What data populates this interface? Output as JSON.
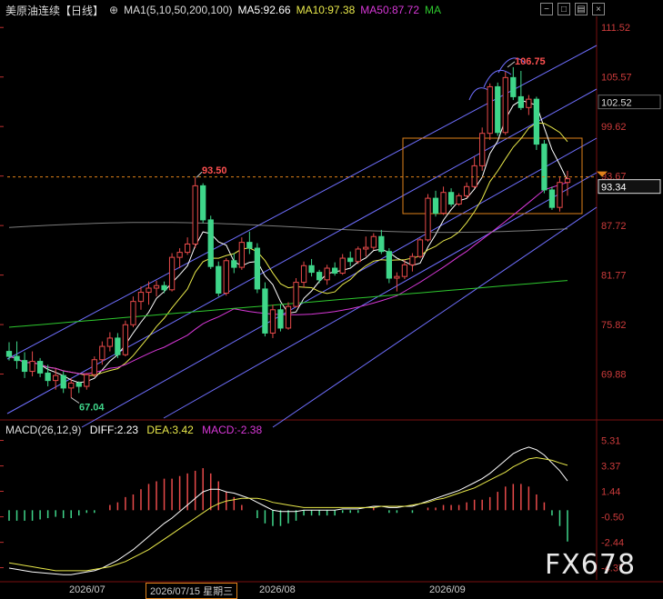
{
  "header": {
    "title": "美原油连续",
    "period": "【日线】",
    "ma_label": "MA1(5,10,50,200,100)",
    "ma5": "MA5:92.66",
    "ma10": "MA10:97.38",
    "ma50": "MA50:87.72",
    "ma_extra": "MA"
  },
  "macd_header": {
    "label": "MACD(26,12,9)",
    "diff": "DIFF:2.23",
    "dea": "DEA:3.42",
    "macd": "MACD:-2.38"
  },
  "price_axis": {
    "ticks": [
      "111.52",
      "105.57",
      "99.62",
      "93.67",
      "87.72",
      "81.77",
      "75.82",
      "69.88"
    ],
    "tick_values": [
      111.52,
      105.57,
      99.62,
      93.67,
      87.72,
      81.77,
      75.82,
      69.88
    ],
    "boxed_label": "102.52",
    "current_label": "93.34",
    "current_value": 93.34
  },
  "macd_axis": {
    "ticks": [
      "5.31",
      "3.37",
      "1.44",
      "-0.50",
      "-2.44",
      "-4.37"
    ],
    "tick_values": [
      5.31,
      3.37,
      1.44,
      -0.5,
      -2.44,
      -4.37
    ]
  },
  "annotations": {
    "high_label": "106.75",
    "high_value": 106.75,
    "mid_label": "93.50",
    "mid_value": 93.5,
    "low_label": "67.04",
    "low_value": 67.04
  },
  "x_axis": {
    "labels": [
      "2026/07",
      "2026/07/15 星期三",
      "2026/08",
      "2026/09"
    ]
  },
  "watermark": "FX678",
  "colors": {
    "up": "#e84a4a",
    "down": "#3fd68a",
    "ma5": "#ffffff",
    "ma10": "#e8e84a",
    "ma50": "#d838d8",
    "ma_long": "#2ec82e",
    "ma_mid": "#9a9a9a",
    "channel": "#6f6fff",
    "box": "#e0821a",
    "macd_up": "#e84a4a",
    "macd_down": "#3fd68a"
  },
  "chart_data": {
    "type": "candlestick",
    "symbol": "美原油连续",
    "candles": [
      [
        72.6,
        73.7,
        71.5,
        72.0
      ],
      [
        72.0,
        73.8,
        70.5,
        71.5
      ],
      [
        71.5,
        72.5,
        69.4,
        70.2
      ],
      [
        70.2,
        72.6,
        69.6,
        71.4
      ],
      [
        71.4,
        71.8,
        69.5,
        70.0
      ],
      [
        70.0,
        71.0,
        68.4,
        69.1
      ],
      [
        69.1,
        70.5,
        68.0,
        69.7
      ],
      [
        69.7,
        70.2,
        67.6,
        68.2
      ],
      [
        68.2,
        69.4,
        67.04,
        68.8
      ],
      [
        68.8,
        69.0,
        67.6,
        68.4
      ],
      [
        68.4,
        70.0,
        68.0,
        69.8
      ],
      [
        69.8,
        72.0,
        69.5,
        71.6
      ],
      [
        71.6,
        73.8,
        71.0,
        73.2
      ],
      [
        73.2,
        74.9,
        72.6,
        74.2
      ],
      [
        74.2,
        74.8,
        71.8,
        72.2
      ],
      [
        72.2,
        76.3,
        72.0,
        75.8
      ],
      [
        75.8,
        79.2,
        75.5,
        78.6
      ],
      [
        78.6,
        80.4,
        77.6,
        79.7
      ],
      [
        79.7,
        81.0,
        78.2,
        80.2
      ],
      [
        80.2,
        81.1,
        79.2,
        80.5
      ],
      [
        80.5,
        81.0,
        79.6,
        80.0
      ],
      [
        80.0,
        84.4,
        79.8,
        83.9
      ],
      [
        83.9,
        85.0,
        82.6,
        84.5
      ],
      [
        84.5,
        86.3,
        84.2,
        85.5
      ],
      [
        85.5,
        93.5,
        85.0,
        92.5
      ],
      [
        92.5,
        92.8,
        88.0,
        88.4
      ],
      [
        88.4,
        88.9,
        82.5,
        82.8
      ],
      [
        82.8,
        83.4,
        79.2,
        79.6
      ],
      [
        79.6,
        83.8,
        79.3,
        83.5
      ],
      [
        83.5,
        84.4,
        82.0,
        82.7
      ],
      [
        82.7,
        86.3,
        82.4,
        85.7
      ],
      [
        85.7,
        87.0,
        84.3,
        85.0
      ],
      [
        85.0,
        85.6,
        79.6,
        80.1
      ],
      [
        80.1,
        80.9,
        74.4,
        74.8
      ],
      [
        74.8,
        78.2,
        74.2,
        77.6
      ],
      [
        77.6,
        78.3,
        75.0,
        75.4
      ],
      [
        75.4,
        78.5,
        75.2,
        78.0
      ],
      [
        78.0,
        81.4,
        77.9,
        80.9
      ],
      [
        80.9,
        83.4,
        80.3,
        82.9
      ],
      [
        82.9,
        83.7,
        81.6,
        82.1
      ],
      [
        82.1,
        82.4,
        80.8,
        81.2
      ],
      [
        81.2,
        83.0,
        80.6,
        82.6
      ],
      [
        82.6,
        83.3,
        81.7,
        82.0
      ],
      [
        82.0,
        84.3,
        81.8,
        83.8
      ],
      [
        83.8,
        84.6,
        82.8,
        83.4
      ],
      [
        83.4,
        85.2,
        83.1,
        84.9
      ],
      [
        84.9,
        86.4,
        84.0,
        85.1
      ],
      [
        85.1,
        86.8,
        84.8,
        86.4
      ],
      [
        86.4,
        87.2,
        84.3,
        84.6
      ],
      [
        84.6,
        85.0,
        80.8,
        81.4
      ],
      [
        81.4,
        82.1,
        79.8,
        81.6
      ],
      [
        81.6,
        83.6,
        81.3,
        83.0
      ],
      [
        83.0,
        84.4,
        82.2,
        84.0
      ],
      [
        84.0,
        86.2,
        83.8,
        86.0
      ],
      [
        86.0,
        91.5,
        85.8,
        91.0
      ],
      [
        91.0,
        91.9,
        88.8,
        89.2
      ],
      [
        89.2,
        92.4,
        89.0,
        91.7
      ],
      [
        91.7,
        92.2,
        90.0,
        90.3
      ],
      [
        90.3,
        91.6,
        90.1,
        91.3
      ],
      [
        91.3,
        92.9,
        91.0,
        92.4
      ],
      [
        92.4,
        96.0,
        92.2,
        94.9
      ],
      [
        94.9,
        99.5,
        94.3,
        98.8
      ],
      [
        98.8,
        104.8,
        98.0,
        104.4
      ],
      [
        104.4,
        104.9,
        98.5,
        98.9
      ],
      [
        98.9,
        106.2,
        98.6,
        105.5
      ],
      [
        105.5,
        106.75,
        102.8,
        103.2
      ],
      [
        103.2,
        106.3,
        101.6,
        101.9
      ],
      [
        101.9,
        103.4,
        101.0,
        102.9
      ],
      [
        102.9,
        103.2,
        96.8,
        97.5
      ],
      [
        97.5,
        98.0,
        91.6,
        92.0
      ],
      [
        92.0,
        92.4,
        89.6,
        89.9
      ],
      [
        89.9,
        93.5,
        89.4,
        92.9
      ],
      [
        92.9,
        94.3,
        91.3,
        93.34
      ]
    ],
    "candle_fields": [
      "open",
      "high",
      "low",
      "close"
    ],
    "price_range": [
      64.8,
      112.2
    ],
    "macd": {
      "diff": [
        -4.4,
        -4.5,
        -4.6,
        -4.7,
        -4.75,
        -4.8,
        -4.85,
        -4.9,
        -4.9,
        -4.8,
        -4.7,
        -4.6,
        -4.4,
        -4.1,
        -3.8,
        -3.4,
        -3.0,
        -2.5,
        -2.0,
        -1.5,
        -1.0,
        -0.6,
        -0.1,
        0.4,
        0.9,
        1.4,
        1.6,
        1.6,
        1.4,
        1.3,
        1.1,
        0.9,
        0.6,
        0.3,
        0.0,
        -0.1,
        -0.1,
        -0.1,
        0.0,
        0.0,
        0.0,
        0.0,
        0.0,
        0.1,
        0.1,
        0.1,
        0.2,
        0.3,
        0.3,
        0.2,
        0.2,
        0.3,
        0.3,
        0.5,
        0.7,
        0.9,
        1.1,
        1.3,
        1.5,
        1.8,
        2.1,
        2.4,
        2.8,
        3.3,
        3.8,
        4.3,
        4.6,
        4.8,
        4.6,
        4.2,
        3.6,
        3.0,
        2.23
      ],
      "dea": [
        -4.0,
        -4.1,
        -4.2,
        -4.3,
        -4.4,
        -4.5,
        -4.6,
        -4.6,
        -4.6,
        -4.6,
        -4.6,
        -4.5,
        -4.4,
        -4.3,
        -4.1,
        -3.9,
        -3.6,
        -3.3,
        -3.0,
        -2.6,
        -2.2,
        -1.8,
        -1.4,
        -1.0,
        -0.6,
        -0.2,
        0.2,
        0.5,
        0.7,
        0.8,
        0.9,
        0.9,
        0.9,
        0.8,
        0.6,
        0.5,
        0.4,
        0.3,
        0.2,
        0.2,
        0.2,
        0.2,
        0.2,
        0.2,
        0.2,
        0.2,
        0.2,
        0.2,
        0.3,
        0.3,
        0.3,
        0.3,
        0.4,
        0.5,
        0.6,
        0.8,
        0.9,
        1.1,
        1.3,
        1.5,
        1.7,
        2.0,
        2.3,
        2.6,
        2.9,
        3.3,
        3.6,
        3.9,
        4.0,
        3.9,
        3.8,
        3.6,
        3.42
      ],
      "hist": [
        -0.8,
        -0.8,
        -0.8,
        -0.8,
        -0.7,
        -0.6,
        -0.5,
        -0.6,
        -0.6,
        -0.4,
        -0.2,
        -0.2,
        0.0,
        0.4,
        0.6,
        1.0,
        1.2,
        1.6,
        2.0,
        2.2,
        2.4,
        2.4,
        2.6,
        2.8,
        3.0,
        3.2,
        2.8,
        2.2,
        1.4,
        1.0,
        0.4,
        0.0,
        -0.6,
        -1.0,
        -1.2,
        -1.2,
        -1.0,
        -0.8,
        -0.4,
        -0.4,
        -0.4,
        -0.4,
        -0.4,
        -0.2,
        -0.2,
        -0.2,
        0.0,
        0.2,
        0.0,
        -0.2,
        -0.2,
        0.0,
        -0.2,
        0.0,
        0.2,
        0.2,
        0.4,
        0.4,
        0.4,
        0.6,
        0.8,
        0.8,
        1.0,
        1.4,
        1.8,
        2.0,
        2.0,
        1.8,
        1.2,
        0.6,
        -0.4,
        -1.2,
        -2.38
      ]
    }
  }
}
